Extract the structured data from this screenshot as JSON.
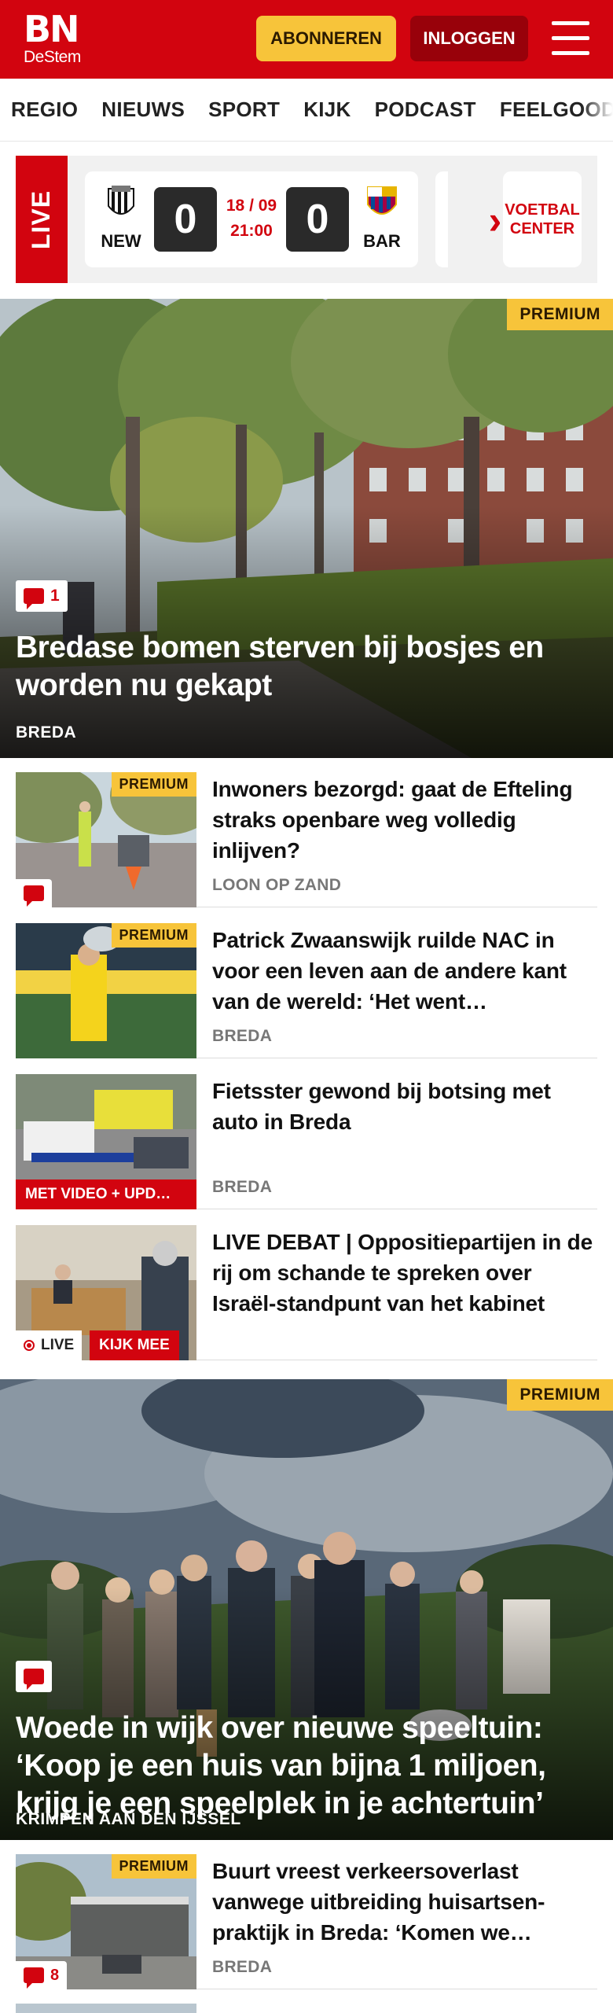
{
  "header": {
    "logo_top": "BN",
    "logo_bottom": "DeStem",
    "subscribe_label": "ABONNEREN",
    "login_label": "INLOGGEN",
    "menu_icon": "hamburger-icon",
    "brand_color": "#d2040f",
    "accent_color": "#f7c43a"
  },
  "nav": {
    "items": [
      "REGIO",
      "NIEUWS",
      "SPORT",
      "KIJK",
      "PODCAST",
      "FEELGOOD"
    ]
  },
  "live": {
    "label": "LIVE",
    "match": {
      "home_code": "NEW",
      "home_score": "0",
      "date": "18 / 09",
      "time": "21:00",
      "away_score": "0",
      "away_code": "BAR"
    },
    "more_label": "VOETBAL CENTER"
  },
  "hero1": {
    "badge": "PREMIUM",
    "comments": "1",
    "title": "Bredase bomen sterven bij bosjes en worden nu gekapt",
    "region": "BREDA"
  },
  "articles": [
    {
      "badge": "PREMIUM",
      "title": "Inwoners bezorgd: gaat de Efteling straks openbare weg volledig inlijven?",
      "region": "LOON OP ZAND",
      "comments": ""
    },
    {
      "badge": "PREMIUM",
      "title": "Patrick Zwaanswijk ruilde NAC in voor een leven aan de andere kant van de wereld: ‘Het went…",
      "region": "BREDA"
    },
    {
      "label": "MET VIDEO + UPD…",
      "title": "Fietsster gewond bij botsing met auto in Breda",
      "region": "BREDA"
    },
    {
      "live_label": "LIVE",
      "watch_label": "KIJK MEE",
      "title": "LIVE DEBAT | Oppositiepartijen in de rij om schande te spreken over Israël-standpunt van het kabinet"
    }
  ],
  "hero2": {
    "badge": "PREMIUM",
    "title": "Woede in wijk over nieuwe speeltuin: ‘Koop je een huis van bijna 1 miljoen, krijg je een speelplek in je achtertuin’",
    "region": "KRIMPEN AAN DEN IJSSEL"
  },
  "article5": {
    "badge": "PREMIUM",
    "comments": "8",
    "title": "Buurt vreest verkeersoverlast vanwege uitbreiding huisartsen-praktijk in Breda: ‘Komen we…",
    "region": "BREDA"
  }
}
